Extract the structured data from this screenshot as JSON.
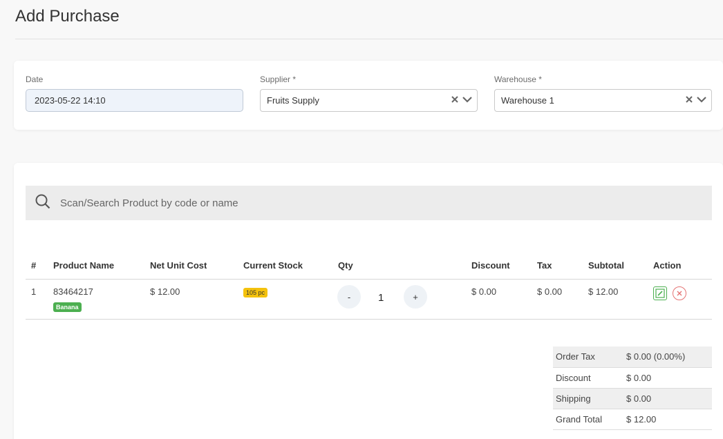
{
  "page": {
    "title": "Add Purchase"
  },
  "form": {
    "date_label": "Date",
    "date_value": "2023-05-22 14:10",
    "supplier_label": "Supplier *",
    "supplier_value": "Fruits Supply",
    "warehouse_label": "Warehouse *",
    "warehouse_value": "Warehouse 1"
  },
  "search": {
    "placeholder": "Scan/Search Product by code or name",
    "icon": "search-icon"
  },
  "table": {
    "headers": [
      "#",
      "Product Name",
      "Net Unit Cost",
      "Current Stock",
      "Qty",
      "Discount",
      "Tax",
      "Subtotal",
      "Action"
    ],
    "rows": [
      {
        "index": "1",
        "code": "83464217",
        "name_badge": "Banana",
        "net_unit_cost": "$ 12.00",
        "stock_badge": "105 pc",
        "qty_minus": "-",
        "qty": "1",
        "qty_plus": "+",
        "discount": "$ 0.00",
        "tax": "$ 0.00",
        "subtotal": "$ 12.00"
      }
    ]
  },
  "totals": [
    {
      "label": "Order Tax",
      "value": "$ 0.00 (0.00%)"
    },
    {
      "label": "Discount",
      "value": "$ 0.00"
    },
    {
      "label": "Shipping",
      "value": "$ 0.00"
    },
    {
      "label": "Grand Total",
      "value": "$ 12.00"
    }
  ],
  "colors": {
    "badge_green": "#4caf50",
    "badge_yellow": "#f4c20d",
    "delete_red": "#e57373"
  }
}
